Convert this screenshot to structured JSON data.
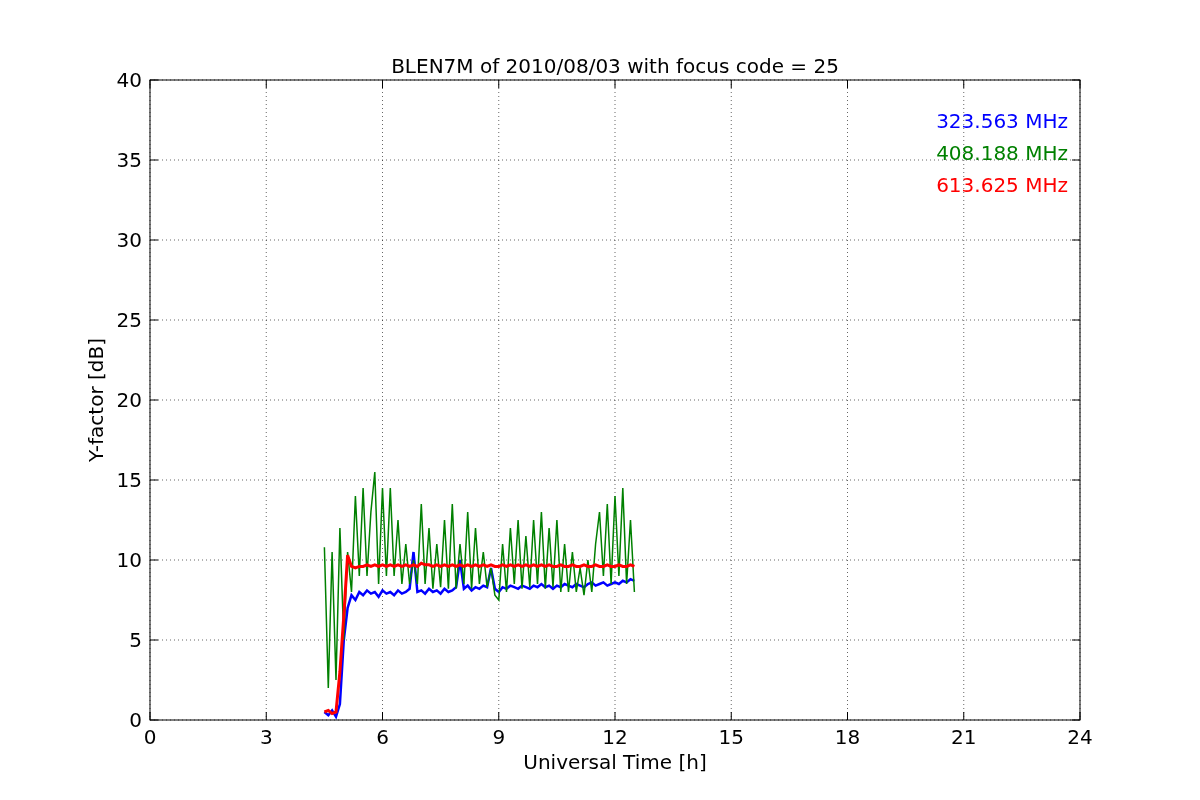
{
  "plot": {
    "chart_data": {
      "type": "line",
      "title": "BLEN7M of 2010/08/03 with focus code = 25",
      "xlabel": "Universal Time [h]",
      "ylabel": "Y-factor [dB]",
      "x": [
        4.5,
        4.6,
        4.7,
        4.8,
        4.9,
        5.0,
        5.1,
        5.2,
        5.3,
        5.4,
        5.5,
        5.6,
        5.7,
        5.8,
        5.9,
        6.0,
        6.1,
        6.2,
        6.3,
        6.4,
        6.5,
        6.6,
        6.7,
        6.8,
        6.9,
        7.0,
        7.1,
        7.2,
        7.3,
        7.4,
        7.5,
        7.6,
        7.7,
        7.8,
        7.9,
        8.0,
        8.1,
        8.2,
        8.3,
        8.4,
        8.5,
        8.6,
        8.7,
        8.8,
        8.9,
        9.0,
        9.1,
        9.2,
        9.3,
        9.4,
        9.5,
        9.6,
        9.7,
        9.8,
        9.9,
        10.0,
        10.1,
        10.2,
        10.3,
        10.4,
        10.5,
        10.6,
        10.7,
        10.8,
        10.9,
        11.0,
        11.1,
        11.2,
        11.3,
        11.4,
        11.5,
        11.6,
        11.7,
        11.8,
        11.9,
        12.0,
        12.1,
        12.2,
        12.3,
        12.4,
        12.5
      ],
      "series": [
        {
          "name": "323.563 MHz",
          "color": "#0000ff",
          "values": [
            0.5,
            0.3,
            0.6,
            0.2,
            1.0,
            5.0,
            7.0,
            7.8,
            7.5,
            8.0,
            7.8,
            8.1,
            7.9,
            8.0,
            7.7,
            8.1,
            7.9,
            8.0,
            7.8,
            8.1,
            7.9,
            8.0,
            8.2,
            10.5,
            8.0,
            8.1,
            7.9,
            8.2,
            8.0,
            8.1,
            7.9,
            8.2,
            8.0,
            8.1,
            8.3,
            10.0,
            8.2,
            8.4,
            8.1,
            8.3,
            8.2,
            8.4,
            8.3,
            9.5,
            8.2,
            8.0,
            8.3,
            8.2,
            8.4,
            8.3,
            8.2,
            8.4,
            8.3,
            8.2,
            8.4,
            8.3,
            8.5,
            8.3,
            8.4,
            8.2,
            8.4,
            8.3,
            8.5,
            8.4,
            8.3,
            8.5,
            8.4,
            8.3,
            8.5,
            8.6,
            8.4,
            8.5,
            8.6,
            8.4,
            8.5,
            8.6,
            8.5,
            8.7,
            8.6,
            8.8,
            8.7
          ]
        },
        {
          "name": "408.188 MHz",
          "color": "#008000",
          "values": [
            10.8,
            2.0,
            10.5,
            2.5,
            12.0,
            5.0,
            10.5,
            8.0,
            14.0,
            9.0,
            14.5,
            9.0,
            13.0,
            15.5,
            8.5,
            14.5,
            9.0,
            14.5,
            9.0,
            12.5,
            8.5,
            11.0,
            8.5,
            10.0,
            8.5,
            13.5,
            8.5,
            12.0,
            8.2,
            11.0,
            8.3,
            12.5,
            8.2,
            13.5,
            8.2,
            11.0,
            8.5,
            13.0,
            8.2,
            12.0,
            8.5,
            10.5,
            8.3,
            9.5,
            7.8,
            7.5,
            11.0,
            8.0,
            12.0,
            8.5,
            12.5,
            8.2,
            11.5,
            8.3,
            12.5,
            8.5,
            13.0,
            8.2,
            12.0,
            8.3,
            12.5,
            8.0,
            11.0,
            8.0,
            10.5,
            8.0,
            9.5,
            7.8,
            10.0,
            8.0,
            11.0,
            13.0,
            9.0,
            13.5,
            8.5,
            14.0,
            9.0,
            14.5,
            8.5,
            12.5,
            8.0
          ]
        },
        {
          "name": "613.625 MHz",
          "color": "#ff0000",
          "values": [
            0.5,
            0.6,
            0.4,
            0.5,
            3.0,
            6.5,
            10.3,
            9.6,
            9.5,
            9.6,
            9.6,
            9.7,
            9.6,
            9.7,
            9.6,
            9.7,
            9.6,
            9.7,
            9.6,
            9.7,
            9.6,
            9.7,
            9.6,
            9.7,
            9.6,
            9.8,
            9.7,
            9.7,
            9.6,
            9.7,
            9.6,
            9.7,
            9.6,
            9.7,
            9.6,
            9.7,
            9.6,
            9.7,
            9.6,
            9.7,
            9.6,
            9.7,
            9.6,
            9.7,
            9.6,
            9.6,
            9.7,
            9.6,
            9.7,
            9.6,
            9.7,
            9.6,
            9.7,
            9.6,
            9.7,
            9.6,
            9.7,
            9.6,
            9.7,
            9.6,
            9.6,
            9.7,
            9.6,
            9.6,
            9.7,
            9.6,
            9.6,
            9.7,
            9.6,
            9.6,
            9.7,
            9.6,
            9.6,
            9.7,
            9.6,
            9.6,
            9.7,
            9.6,
            9.6,
            9.7,
            9.6
          ]
        }
      ],
      "xlim": [
        0,
        24
      ],
      "ylim": [
        0,
        40
      ],
      "xticks": [
        0,
        3,
        6,
        9,
        12,
        15,
        18,
        21,
        24
      ],
      "yticks": [
        0,
        5,
        10,
        15,
        20,
        25,
        30,
        35,
        40
      ],
      "grid": true
    }
  }
}
